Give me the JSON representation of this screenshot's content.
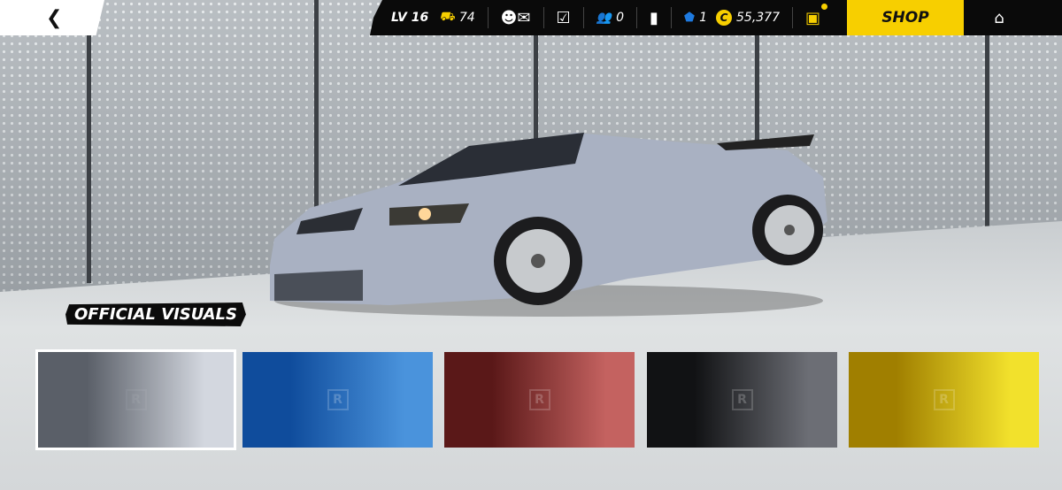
{
  "header": {
    "level": "LV 16",
    "cars_count": "74",
    "friends_count": "0",
    "tokens": "1",
    "credits": "55,377",
    "shop_label": "SHOP"
  },
  "badge": "OFFICIAL VISUALS",
  "swatches": [
    {
      "name": "silver",
      "rarity": "R",
      "from": "#5a5f68",
      "to": "#d3d7df",
      "selected": true
    },
    {
      "name": "blue",
      "rarity": "R",
      "from": "#0f4c9c",
      "to": "#4a93dc",
      "selected": false
    },
    {
      "name": "red",
      "rarity": "R",
      "from": "#5a1818",
      "to": "#c46260",
      "selected": false
    },
    {
      "name": "black",
      "rarity": "R",
      "from": "#111214",
      "to": "#6c6e75",
      "selected": false
    },
    {
      "name": "yellow",
      "rarity": "R",
      "from": "#a07f00",
      "to": "#f2e12c",
      "selected": false
    }
  ]
}
